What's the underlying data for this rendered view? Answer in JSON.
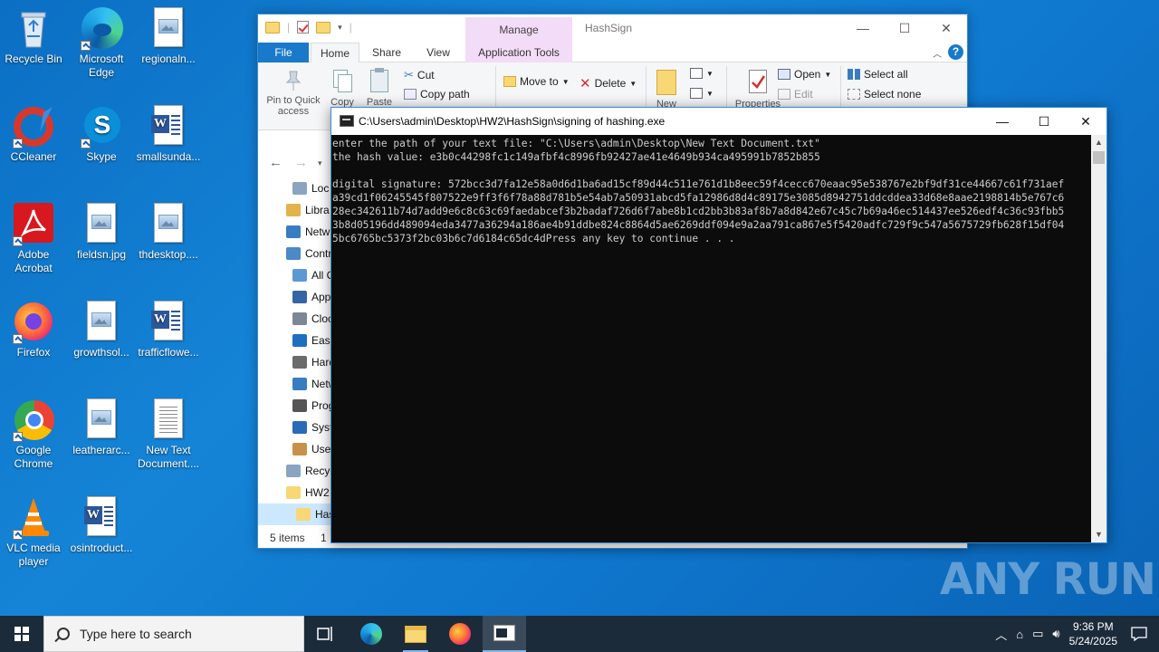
{
  "desktop": {
    "icons": [
      {
        "label": "Recycle Bin"
      },
      {
        "label": "Microsoft Edge"
      },
      {
        "label": "regionaln..."
      },
      {
        "label": "CCleaner"
      },
      {
        "label": "Skype"
      },
      {
        "label": "smallsunda..."
      },
      {
        "label": "Adobe Acrobat"
      },
      {
        "label": "fieldsn.jpg"
      },
      {
        "label": "thdesktop...."
      },
      {
        "label": "Firefox"
      },
      {
        "label": "growthsol..."
      },
      {
        "label": "trafficflowe..."
      },
      {
        "label": "Google Chrome"
      },
      {
        "label": "leatherarc..."
      },
      {
        "label": "New Text Document...."
      },
      {
        "label": "VLC media player"
      },
      {
        "label": "osintroduct..."
      }
    ]
  },
  "explorer": {
    "title": "HashSign",
    "manage_label": "Manage",
    "tabs": {
      "file": "File",
      "home": "Home",
      "share": "Share",
      "view": "View",
      "app_tools": "Application Tools"
    },
    "ribbon": {
      "pin_label_1": "Pin to Quick",
      "pin_label_2": "access",
      "copy": "Copy",
      "paste": "Paste",
      "cut": "Cut",
      "copy_path": "Copy path",
      "move_to": "Move to",
      "delete": "Delete",
      "new": "New",
      "properties": "Properties",
      "open": "Open",
      "edit": "Edit",
      "select_all": "Select all",
      "select_none": "Select none"
    },
    "tree": [
      {
        "label": "Loc",
        "color": "#8aa4c2"
      },
      {
        "label": "Libra",
        "color": "#e2b34a"
      },
      {
        "label": "Netw",
        "color": "#3a7cc2"
      },
      {
        "label": "Contr",
        "color": "#4b89c7"
      },
      {
        "label": "All C",
        "color": "#5c98d4"
      },
      {
        "label": "Appe",
        "color": "#3465a4"
      },
      {
        "label": "Clocl",
        "color": "#7b8794"
      },
      {
        "label": "Ease",
        "color": "#1f6fbf"
      },
      {
        "label": "Hard",
        "color": "#6b6b6b"
      },
      {
        "label": "Netw",
        "color": "#3a7cc2"
      },
      {
        "label": "Prog",
        "color": "#555555"
      },
      {
        "label": "Syst",
        "color": "#2a6bb8"
      },
      {
        "label": "User",
        "color": "#c8914a"
      },
      {
        "label": "Recyc",
        "color": "#8aa4c2"
      },
      {
        "label": "HW2",
        "color": "#f8d775"
      },
      {
        "label": "Hash",
        "color": "#f8d775"
      }
    ],
    "status": {
      "items": "5 items",
      "selected": "1"
    }
  },
  "console": {
    "title": "C:\\Users\\admin\\Desktop\\HW2\\HashSign\\signing of hashing.exe",
    "lines": [
      "enter the path of your text file: \"C:\\Users\\admin\\Desktop\\New Text Document.txt\"",
      "the hash value: e3b0c44298fc1c149afbf4c8996fb92427ae41e4649b934ca495991b7852b855",
      "",
      "digital signature: 572bcc3d7fa12e58a0d6d1ba6ad15cf89d44c511e761d1b8eec59f4cecc670eaac95e538767e2bf9df31ce44667c61f731aef",
      "a39cd1f06245545f807522e9ff3f6f78a88d781b5e54ab7a50931abcd5fa12986d8d4c89175e3085d8942751ddcddea33d68e8aae2198814b5e767c6",
      "28ec342611b74d7add9e6c8c63c69faedabcef3b2badaf726d6f7abe8b1cd2bb3b83af8b7a8d842e67c45c7b69a46ec514437ee526edf4c36c93fbb5",
      "3b8d05196dd489094eda3477a36294a186ae4b91ddbe824c8864d5ae6269ddf094e9a2aa791ca867e5f5420adfc729f9c547a5675729fb628f15df04",
      "5bc6765bc5373f2bc03b6c7d6184c65dc4dPress any key to continue . . ."
    ]
  },
  "watermark": "ANY RUN",
  "taskbar": {
    "search_placeholder": "Type here to search",
    "time": "9:36 PM",
    "date": "5/24/2025"
  }
}
